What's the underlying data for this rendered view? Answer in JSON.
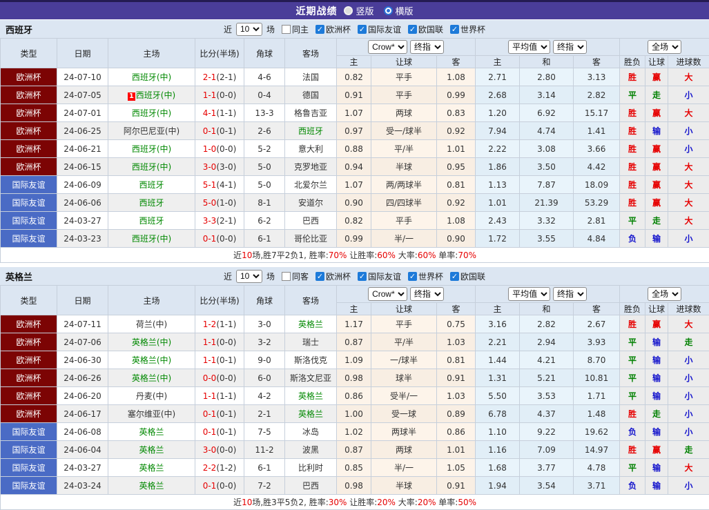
{
  "icons": {
    "check": "✓"
  },
  "title_bar": {
    "title": "近期战绩",
    "layout_options": [
      {
        "label": "竖版",
        "selected": false
      },
      {
        "label": "横版",
        "selected": true
      }
    ]
  },
  "filter_labels": {
    "near": "近",
    "games": "场"
  },
  "table_header": {
    "type": "类型",
    "date": "日期",
    "home": "主场",
    "score": "比分(半场)",
    "corner": "角球",
    "away": "客场",
    "selects": {
      "bookmaker": "Crow*",
      "bookmaker_period": "终指",
      "average": "平均值",
      "average_period": "终指",
      "scope": "全场"
    },
    "sub": {
      "home_odds": "主",
      "handicap": "让球",
      "away_odds": "客",
      "avg_home": "主",
      "avg_draw": "和",
      "avg_away": "客",
      "result_wl": "胜负",
      "result_handicap": "让球",
      "result_goals": "进球数"
    }
  },
  "row_fields": [
    "league",
    "date",
    "home",
    "home_highlight",
    "score",
    "half_score",
    "corners",
    "away",
    "away_highlight",
    "crown_home",
    "crown_handicap",
    "crown_away",
    "avg_home",
    "avg_draw",
    "avg_away",
    "result_wl",
    "result_handicap",
    "result_goals",
    "badge"
  ],
  "league_colors": {
    "欧洲杯": "#7c0404",
    "国际友谊": "#4a6bc5"
  },
  "result_colors": {
    "win_red": "#e60000",
    "draw_green": "#008000",
    "lose_blue": "#1414cc"
  },
  "sections": [
    {
      "team": "西班牙",
      "filter": {
        "games_value": "10",
        "same_label": "同主",
        "same_checked": false,
        "leagues": [
          {
            "label": "欧洲杯",
            "checked": true
          },
          {
            "label": "国际友谊",
            "checked": true
          },
          {
            "label": "欧国联",
            "checked": true
          },
          {
            "label": "世界杯",
            "checked": true
          }
        ]
      },
      "rows": [
        [
          "欧洲杯",
          "24-07-10",
          "西班牙(中)",
          1,
          "2-1",
          "(2-1)",
          "4-6",
          "法国",
          0,
          "0.82",
          "平手",
          "1.08",
          "2.71",
          "2.80",
          "3.13",
          "胜",
          "赢",
          "大",
          ""
        ],
        [
          "欧洲杯",
          "24-07-05",
          "西班牙(中)",
          1,
          "1-1",
          "(0-0)",
          "0-4",
          "德国",
          0,
          "0.91",
          "平手",
          "0.99",
          "2.68",
          "3.14",
          "2.82",
          "平",
          "走",
          "小",
          "1"
        ],
        [
          "欧洲杯",
          "24-07-01",
          "西班牙(中)",
          1,
          "4-1",
          "(1-1)",
          "13-3",
          "格鲁吉亚",
          0,
          "1.07",
          "两球",
          "0.83",
          "1.20",
          "6.92",
          "15.17",
          "胜",
          "赢",
          "大",
          ""
        ],
        [
          "欧洲杯",
          "24-06-25",
          "阿尔巴尼亚(中)",
          0,
          "0-1",
          "(0-1)",
          "2-6",
          "西班牙",
          1,
          "0.97",
          "受一/球半",
          "0.92",
          "7.94",
          "4.74",
          "1.41",
          "胜",
          "输",
          "小",
          ""
        ],
        [
          "欧洲杯",
          "24-06-21",
          "西班牙(中)",
          1,
          "1-0",
          "(0-0)",
          "5-2",
          "意大利",
          0,
          "0.88",
          "平/半",
          "1.01",
          "2.22",
          "3.08",
          "3.66",
          "胜",
          "赢",
          "小",
          ""
        ],
        [
          "欧洲杯",
          "24-06-15",
          "西班牙(中)",
          1,
          "3-0",
          "(3-0)",
          "5-0",
          "克罗地亚",
          0,
          "0.94",
          "半球",
          "0.95",
          "1.86",
          "3.50",
          "4.42",
          "胜",
          "赢",
          "大",
          ""
        ],
        [
          "国际友谊",
          "24-06-09",
          "西班牙",
          1,
          "5-1",
          "(4-1)",
          "5-0",
          "北爱尔兰",
          0,
          "1.07",
          "两/两球半",
          "0.81",
          "1.13",
          "7.87",
          "18.09",
          "胜",
          "赢",
          "大",
          ""
        ],
        [
          "国际友谊",
          "24-06-06",
          "西班牙",
          1,
          "5-0",
          "(1-0)",
          "8-1",
          "安道尔",
          0,
          "0.90",
          "四/四球半",
          "0.92",
          "1.01",
          "21.39",
          "53.29",
          "胜",
          "赢",
          "大",
          ""
        ],
        [
          "国际友谊",
          "24-03-27",
          "西班牙",
          1,
          "3-3",
          "(2-1)",
          "6-2",
          "巴西",
          0,
          "0.82",
          "平手",
          "1.08",
          "2.43",
          "3.32",
          "2.81",
          "平",
          "走",
          "大",
          ""
        ],
        [
          "国际友谊",
          "24-03-23",
          "西班牙(中)",
          1,
          "0-1",
          "(0-0)",
          "6-1",
          "哥伦比亚",
          0,
          "0.99",
          "半/一",
          "0.90",
          "1.72",
          "3.55",
          "4.84",
          "负",
          "输",
          "小",
          ""
        ]
      ],
      "summary": [
        [
          "近",
          0
        ],
        [
          "10",
          1
        ],
        [
          "场,胜7平2负1, 胜率:",
          0
        ],
        [
          "70%",
          1
        ],
        [
          " 让胜率:",
          0
        ],
        [
          "60%",
          1
        ],
        [
          " 大率:",
          0
        ],
        [
          "60%",
          1
        ],
        [
          " 单率:",
          0
        ],
        [
          "70%",
          1
        ]
      ]
    },
    {
      "team": "英格兰",
      "filter": {
        "games_value": "10",
        "same_label": "同客",
        "same_checked": false,
        "leagues": [
          {
            "label": "欧洲杯",
            "checked": true
          },
          {
            "label": "国际友谊",
            "checked": true
          },
          {
            "label": "世界杯",
            "checked": true
          },
          {
            "label": "欧国联",
            "checked": true
          }
        ]
      },
      "rows": [
        [
          "欧洲杯",
          "24-07-11",
          "荷兰(中)",
          0,
          "1-2",
          "(1-1)",
          "3-0",
          "英格兰",
          1,
          "1.17",
          "平手",
          "0.75",
          "3.16",
          "2.82",
          "2.67",
          "胜",
          "赢",
          "大",
          ""
        ],
        [
          "欧洲杯",
          "24-07-06",
          "英格兰(中)",
          1,
          "1-1",
          "(0-0)",
          "3-2",
          "瑞士",
          0,
          "0.87",
          "平/半",
          "1.03",
          "2.21",
          "2.94",
          "3.93",
          "平",
          "输",
          "走",
          ""
        ],
        [
          "欧洲杯",
          "24-06-30",
          "英格兰(中)",
          1,
          "1-1",
          "(0-1)",
          "9-0",
          "斯洛伐克",
          0,
          "1.09",
          "一/球半",
          "0.81",
          "1.44",
          "4.21",
          "8.70",
          "平",
          "输",
          "小",
          ""
        ],
        [
          "欧洲杯",
          "24-06-26",
          "英格兰(中)",
          1,
          "0-0",
          "(0-0)",
          "6-0",
          "斯洛文尼亚",
          0,
          "0.98",
          "球半",
          "0.91",
          "1.31",
          "5.21",
          "10.81",
          "平",
          "输",
          "小",
          ""
        ],
        [
          "欧洲杯",
          "24-06-20",
          "丹麦(中)",
          0,
          "1-1",
          "(1-1)",
          "4-2",
          "英格兰",
          1,
          "0.86",
          "受半/一",
          "1.03",
          "5.50",
          "3.53",
          "1.71",
          "平",
          "输",
          "小",
          ""
        ],
        [
          "欧洲杯",
          "24-06-17",
          "塞尔维亚(中)",
          0,
          "0-1",
          "(0-1)",
          "2-1",
          "英格兰",
          1,
          "1.00",
          "受一球",
          "0.89",
          "6.78",
          "4.37",
          "1.48",
          "胜",
          "走",
          "小",
          ""
        ],
        [
          "国际友谊",
          "24-06-08",
          "英格兰",
          1,
          "0-1",
          "(0-1)",
          "7-5",
          "冰岛",
          0,
          "1.02",
          "两球半",
          "0.86",
          "1.10",
          "9.22",
          "19.62",
          "负",
          "输",
          "小",
          ""
        ],
        [
          "国际友谊",
          "24-06-04",
          "英格兰",
          1,
          "3-0",
          "(0-0)",
          "11-2",
          "波黑",
          0,
          "0.87",
          "两球",
          "1.01",
          "1.16",
          "7.09",
          "14.97",
          "胜",
          "赢",
          "走",
          ""
        ],
        [
          "国际友谊",
          "24-03-27",
          "英格兰",
          1,
          "2-2",
          "(1-2)",
          "6-1",
          "比利时",
          0,
          "0.85",
          "半/一",
          "1.05",
          "1.68",
          "3.77",
          "4.78",
          "平",
          "输",
          "大",
          ""
        ],
        [
          "国际友谊",
          "24-03-24",
          "英格兰",
          1,
          "0-1",
          "(0-0)",
          "7-2",
          "巴西",
          0,
          "0.98",
          "半球",
          "0.91",
          "1.94",
          "3.54",
          "3.71",
          "负",
          "输",
          "小",
          ""
        ]
      ],
      "summary": [
        [
          "近",
          0
        ],
        [
          "10",
          1
        ],
        [
          "场,胜3平5负2, 胜率:",
          0
        ],
        [
          "30%",
          1
        ],
        [
          " 让胜率:",
          0
        ],
        [
          "20%",
          1
        ],
        [
          " 大率:",
          0
        ],
        [
          "20%",
          1
        ],
        [
          " 单率:",
          0
        ],
        [
          "50%",
          1
        ]
      ]
    }
  ]
}
